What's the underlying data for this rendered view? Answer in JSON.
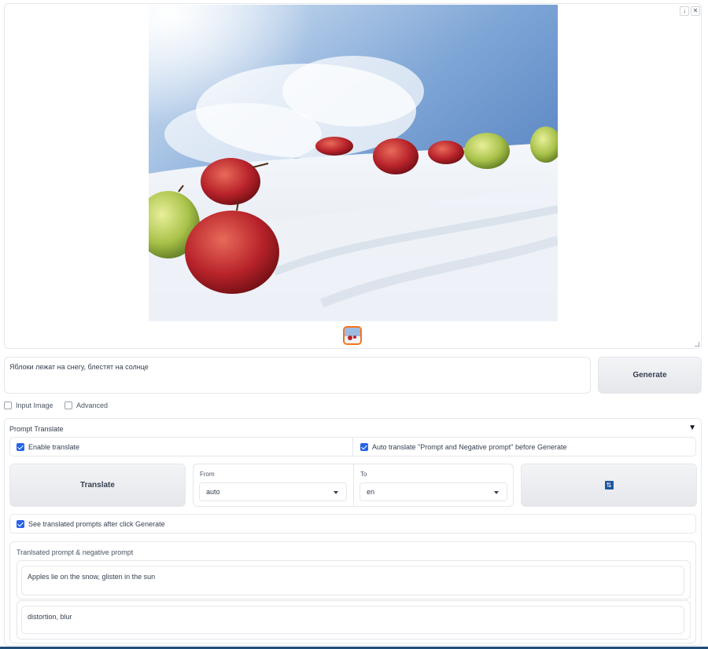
{
  "gallery": {
    "download_icon": "download-icon",
    "close_icon": "close-icon"
  },
  "prompt": {
    "value": "Яблоки лежат на снегу, блестят на солнце"
  },
  "generate": {
    "label": "Generate"
  },
  "options": {
    "input_image": {
      "label": "Input Image",
      "checked": false
    },
    "advanced": {
      "label": "Advanced",
      "checked": false
    }
  },
  "prompt_translate": {
    "title": "Prompt Translate",
    "enable_translate": {
      "label": "Enable translate",
      "checked": true
    },
    "auto_translate": {
      "label": "Auto translate \"Prompt and Negative prompt\" before Generate",
      "checked": true
    },
    "translate_button": "Translate",
    "from": {
      "label": "From",
      "value": "auto"
    },
    "to": {
      "label": "To",
      "value": "en"
    },
    "swap_icon": "swap-icon",
    "see_translated": {
      "label": "See translated prompts after click Generate",
      "checked": true
    },
    "translated_group": {
      "title": "Tranlsated prompt & negative prompt",
      "prompt": "Apples lie on the snow, glisten in the sun",
      "negative": "distortion, blur"
    }
  },
  "colors": {
    "accent": "#2563eb",
    "thumb_border": "#f97316",
    "swap_icon_bg": "#1e56a0"
  }
}
